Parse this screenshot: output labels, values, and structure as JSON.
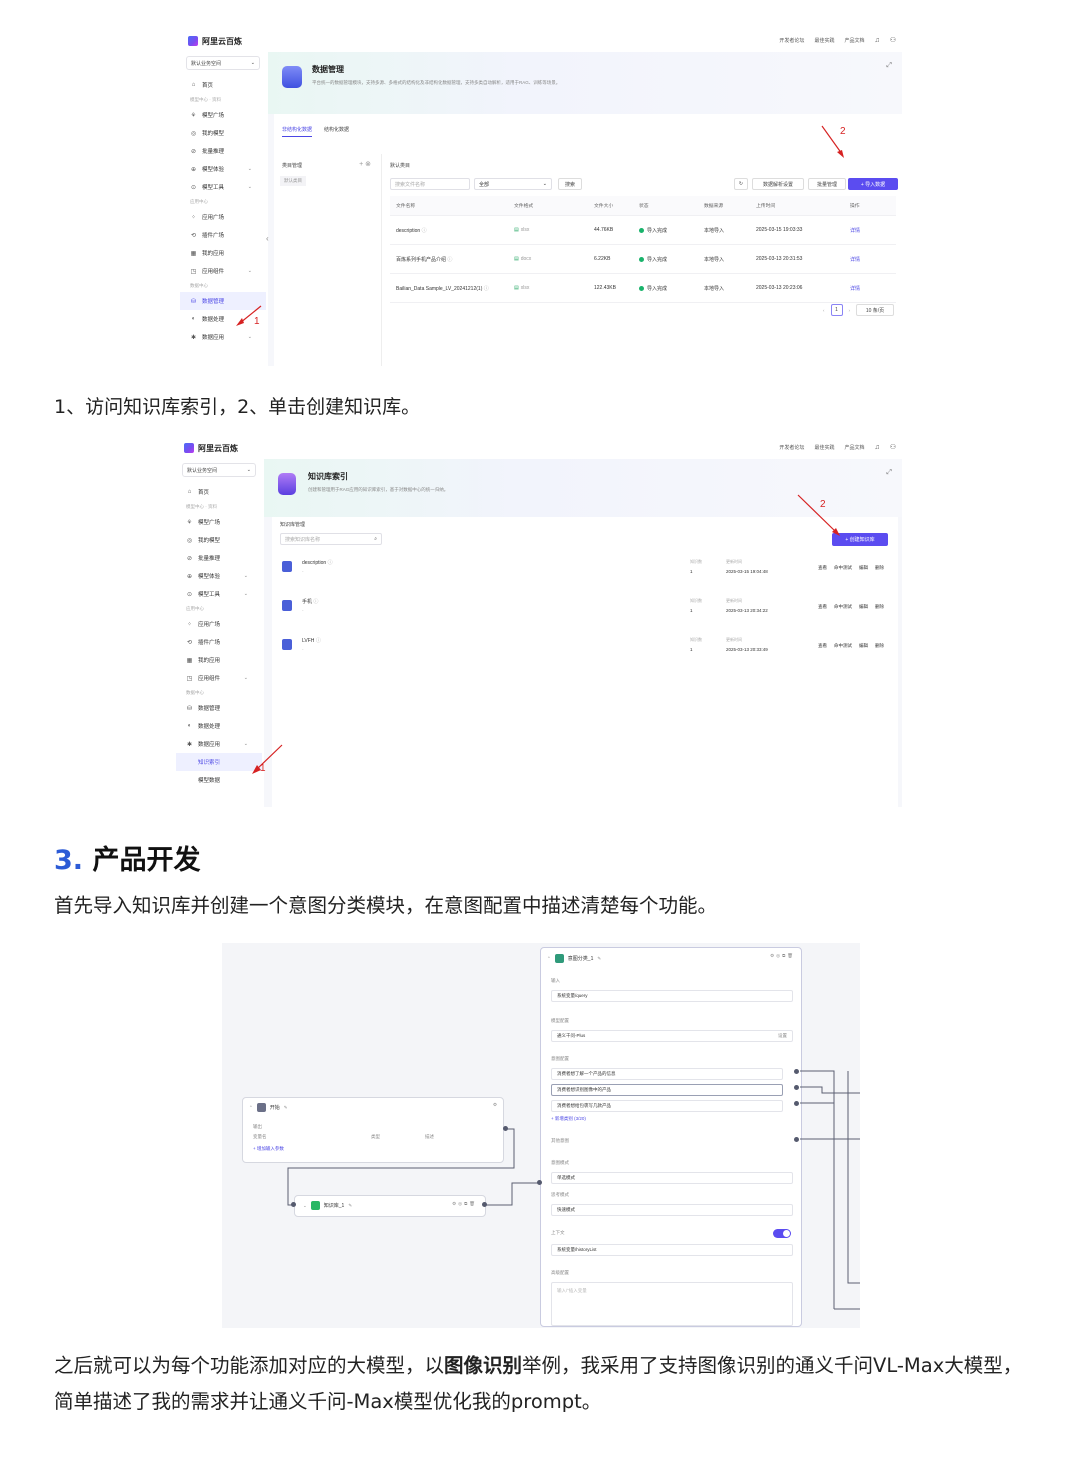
{
  "shot1": {
    "brand": "阿里云百炼",
    "top_links": [
      "开发者论坛",
      "最佳实践",
      "产品文档"
    ],
    "workspace": "默认业务空间",
    "nav": [
      {
        "type": "item",
        "icon": "home-icon",
        "label": "首页"
      },
      {
        "type": "group",
        "label": "模型中心 · 资料"
      },
      {
        "type": "item",
        "icon": "model-plaza-icon",
        "label": "模型广场"
      },
      {
        "type": "item",
        "icon": "my-model-icon",
        "label": "我的模型"
      },
      {
        "type": "item",
        "icon": "batch-icon",
        "label": "批量推理"
      },
      {
        "type": "item",
        "icon": "experience-icon",
        "label": "模型体验",
        "chevron": true
      },
      {
        "type": "item",
        "icon": "tools-icon",
        "label": "模型工具",
        "chevron": true
      },
      {
        "type": "group",
        "label": "应用中心"
      },
      {
        "type": "item",
        "icon": "app-plaza-icon",
        "label": "应用广场"
      },
      {
        "type": "item",
        "icon": "plugin-icon",
        "label": "插件广场"
      },
      {
        "type": "item",
        "icon": "my-app-icon",
        "label": "我的应用"
      },
      {
        "type": "item",
        "icon": "component-icon",
        "label": "应用组件",
        "chevron": true
      },
      {
        "type": "group",
        "label": "数据中心"
      },
      {
        "type": "item",
        "icon": "data-manage-icon",
        "label": "数据管理",
        "active": true
      },
      {
        "type": "item",
        "icon": "data-process-icon",
        "label": "数据处理"
      },
      {
        "type": "item",
        "icon": "data-app-icon",
        "label": "数据应用",
        "chevron": true
      }
    ],
    "header": {
      "title": "数据管理",
      "desc": "平台统一的数据管理模块，支持多源、多格式的结构化及非结构化数据管理，支持多类自动解析，适用于RAG、训练等场景。"
    },
    "tabs": [
      "非结构化数据",
      "结构化数据"
    ],
    "category": {
      "title": "类目管理",
      "items": [
        "默认类目"
      ]
    },
    "right_title": "默认类目",
    "search_placeholder": "搜索文件名称",
    "filter_value": "全部",
    "search_button": "搜索",
    "buttons": {
      "parse_settings": "数据解析设置",
      "batch": "批量管理",
      "import": "+ 导入数据"
    },
    "columns": [
      "文件名称",
      "文件格式",
      "文件大小",
      "状态",
      "数据来源",
      "上传时间",
      "操作"
    ],
    "rows": [
      {
        "name": "description",
        "format": "xlsx",
        "size": "44.76KB",
        "status": "导入完成",
        "source": "本地导入",
        "time": "2025-03-15 19:03:33",
        "op": "详情"
      },
      {
        "name": "百炼系列手机产品介绍",
        "format": "docx",
        "size": "6.22KB",
        "status": "导入完成",
        "source": "本地导入",
        "time": "2025-03-13 20:31:53",
        "op": "详情"
      },
      {
        "name": "Bailian_Data Sample_LV_20241212(1)",
        "format": "xlsx",
        "size": "122.43KB",
        "status": "导入完成",
        "source": "本地导入",
        "time": "2025-03-13 20:23:06",
        "op": "详情"
      }
    ],
    "pagination": {
      "page": "1",
      "page_size": "10 条/页"
    },
    "marks": {
      "one": "1",
      "two": "2"
    }
  },
  "caption1": "1、访问知识库索引，2、单击创建知识库。",
  "shot2": {
    "brand": "阿里云百炼",
    "top_links": [
      "开发者论坛",
      "最佳实践",
      "产品文档"
    ],
    "workspace": "默认业务空间",
    "nav": [
      {
        "type": "item",
        "icon": "home-icon",
        "label": "首页"
      },
      {
        "type": "group",
        "label": "模型中心 · 资料"
      },
      {
        "type": "item",
        "icon": "model-plaza-icon",
        "label": "模型广场"
      },
      {
        "type": "item",
        "icon": "my-model-icon",
        "label": "我的模型"
      },
      {
        "type": "item",
        "icon": "batch-icon",
        "label": "批量推理"
      },
      {
        "type": "item",
        "icon": "experience-icon",
        "label": "模型体验",
        "chevron": true
      },
      {
        "type": "item",
        "icon": "tools-icon",
        "label": "模型工具",
        "chevron": true
      },
      {
        "type": "group",
        "label": "应用中心"
      },
      {
        "type": "item",
        "icon": "app-plaza-icon",
        "label": "应用广场"
      },
      {
        "type": "item",
        "icon": "plugin-icon",
        "label": "插件广场"
      },
      {
        "type": "item",
        "icon": "my-app-icon",
        "label": "我的应用"
      },
      {
        "type": "item",
        "icon": "component-icon",
        "label": "应用组件",
        "chevron": true
      },
      {
        "type": "group",
        "label": "数据中心"
      },
      {
        "type": "item",
        "icon": "data-manage-icon",
        "label": "数据管理"
      },
      {
        "type": "item",
        "icon": "data-process-icon",
        "label": "数据处理"
      },
      {
        "type": "item",
        "icon": "data-app-icon",
        "label": "数据应用",
        "chevron": true
      },
      {
        "type": "sub",
        "label": "知识索引",
        "active": true
      },
      {
        "type": "sub",
        "label": "模型数据"
      }
    ],
    "header": {
      "title": "知识库索引",
      "desc": "创建和管理用于RAG应用的知识库索引，基于对数据中心的统一归纳。"
    },
    "section_title": "知识库管理",
    "search_placeholder": "搜索知识库名称",
    "create_button": "+ 创建知识库",
    "meta_heads": [
      "知识数",
      "更新时间"
    ],
    "ops": [
      "查看",
      "命中测试",
      "编辑",
      "删除"
    ],
    "rows": [
      {
        "name": "description",
        "count": "1",
        "time": "2025-03-15 19:04:48"
      },
      {
        "name": "手机",
        "count": "1",
        "time": "2025-03-13 20:34:22"
      },
      {
        "name": "LVFH",
        "count": "1",
        "time": "2025-03-13 20:33:49"
      }
    ],
    "marks": {
      "one": "1",
      "two": "2"
    }
  },
  "section": {
    "number": "3.",
    "title": "产品开发"
  },
  "para1": "首先导入知识库并创建一个意图分类模块，在意图配置中描述清楚每个功能。",
  "shot3": {
    "start_node": {
      "title": "开始",
      "output_label": "输出",
      "cols": [
        "变量名",
        "类型",
        "描述"
      ],
      "add": "+ 增加输入参数"
    },
    "kb_node": {
      "title": "知识库_1"
    },
    "intent_node": {
      "title": "意图分类_1",
      "input_label": "输入",
      "input_value": "系统变量/query",
      "model_label": "模型配置",
      "model_value": "通义千问-Plus",
      "model_setting": "设置",
      "intent_label": "意图配置",
      "intents": [
        "消费者想了解一个产品的信息",
        "消费者想识别图像中的产品",
        "消费者想给包裹写几款产品"
      ],
      "add_intent": "+ 新增类别 (3/20)",
      "other_label": "其他意图",
      "mode_label": "意图模式",
      "mode_value": "单选模式",
      "think_label": "思考模式",
      "think_value": "快速模式",
      "context_label": "上下文",
      "context_value": "系统变量/historyList",
      "prompt_label": "高级配置",
      "prompt_placeholder": "输入/“插入变量"
    }
  },
  "para2": {
    "before": "之后就可以为每个功能添加对应的大模型，以",
    "bold": "图像识别",
    "after": "举例，我采用了支持图像识别的通义千问VL-Max大模型，简单描述了我的需求并让通义千问-Max模型优化我的prompt。"
  }
}
